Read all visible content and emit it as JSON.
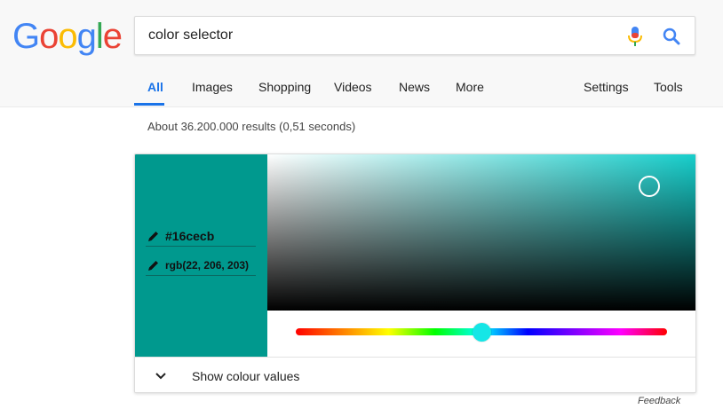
{
  "logo": {
    "letters": [
      "G",
      "o",
      "o",
      "g",
      "l",
      "e"
    ],
    "colors": [
      "#4285f4",
      "#ea4335",
      "#fbbc05",
      "#4285f4",
      "#34a853",
      "#ea4335"
    ]
  },
  "search": {
    "query": "color selector",
    "mic_icon": "microphone-icon",
    "search_icon": "magnifier-icon"
  },
  "tabs": {
    "all": "All",
    "images": "Images",
    "shopping": "Shopping",
    "videos": "Videos",
    "news": "News",
    "more": "More",
    "settings": "Settings",
    "tools": "Tools"
  },
  "results_count": "About 36.200.000 results (0,51 seconds)",
  "color_picker": {
    "hex": "#16cecb",
    "rgb": "rgb(22, 206, 203)",
    "swatch_color": "#00998e",
    "show_values_label": "Show colour values",
    "accent": "#1a73e8"
  },
  "feedback": "Feedback"
}
